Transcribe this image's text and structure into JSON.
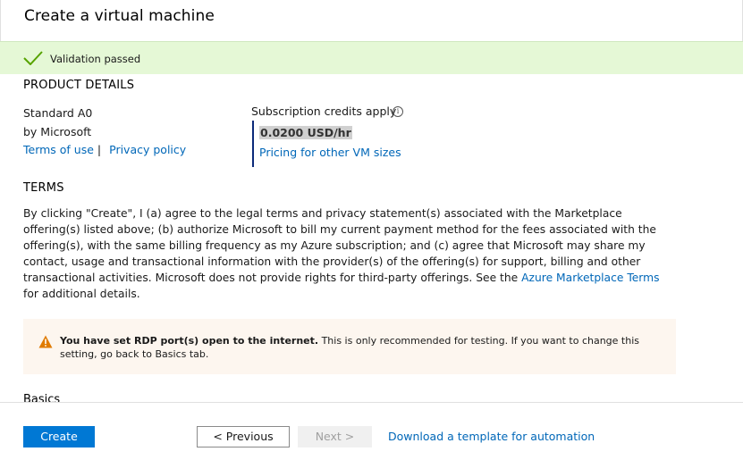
{
  "header": {
    "title": "Create a virtual machine"
  },
  "validation": {
    "message": "Validation passed",
    "color": "#e5f8d6"
  },
  "product_details": {
    "heading": "PRODUCT DETAILS",
    "name": "Standard A0",
    "publisher": "by Microsoft",
    "terms_of_use_link": "Terms of use",
    "separator": "|",
    "privacy_link": "Privacy policy",
    "credits_label": "Subscription credits apply",
    "info_glyph": "i",
    "price": "0.0200 USD/hr",
    "pricing_link": "Pricing for other VM sizes"
  },
  "terms": {
    "heading": "TERMS",
    "body_prefix": "By clicking \"Create\", I (a) agree to the legal terms and privacy statement(s) associated with the Marketplace offering(s) listed above; (b) authorize Microsoft to bill my current payment method for the fees associated with the offering(s), with the same billing frequency as my Azure subscription; and (c) agree that Microsoft may share my contact, usage and transactional information with the provider(s) of the offering(s) for support, billing and other transactional activities. Microsoft does not provide rights for third-party offerings. See the ",
    "marketplace_link": "Azure Marketplace Terms",
    "body_suffix": " for additional details."
  },
  "warning": {
    "bold": "You have set RDP port(s) open to the internet.",
    "text": "  This is only recommended for testing.  If you want to change this setting, go back to Basics tab.",
    "color": "#fdf6ef",
    "icon_color": "#e07b00"
  },
  "basics_heading": "Basics",
  "footer": {
    "create_label": "Create",
    "previous_label": "< Previous",
    "next_label": "Next >",
    "download_link": "Download a template for automation"
  },
  "colors": {
    "accent": "#0078d4",
    "link": "#0067b8"
  }
}
